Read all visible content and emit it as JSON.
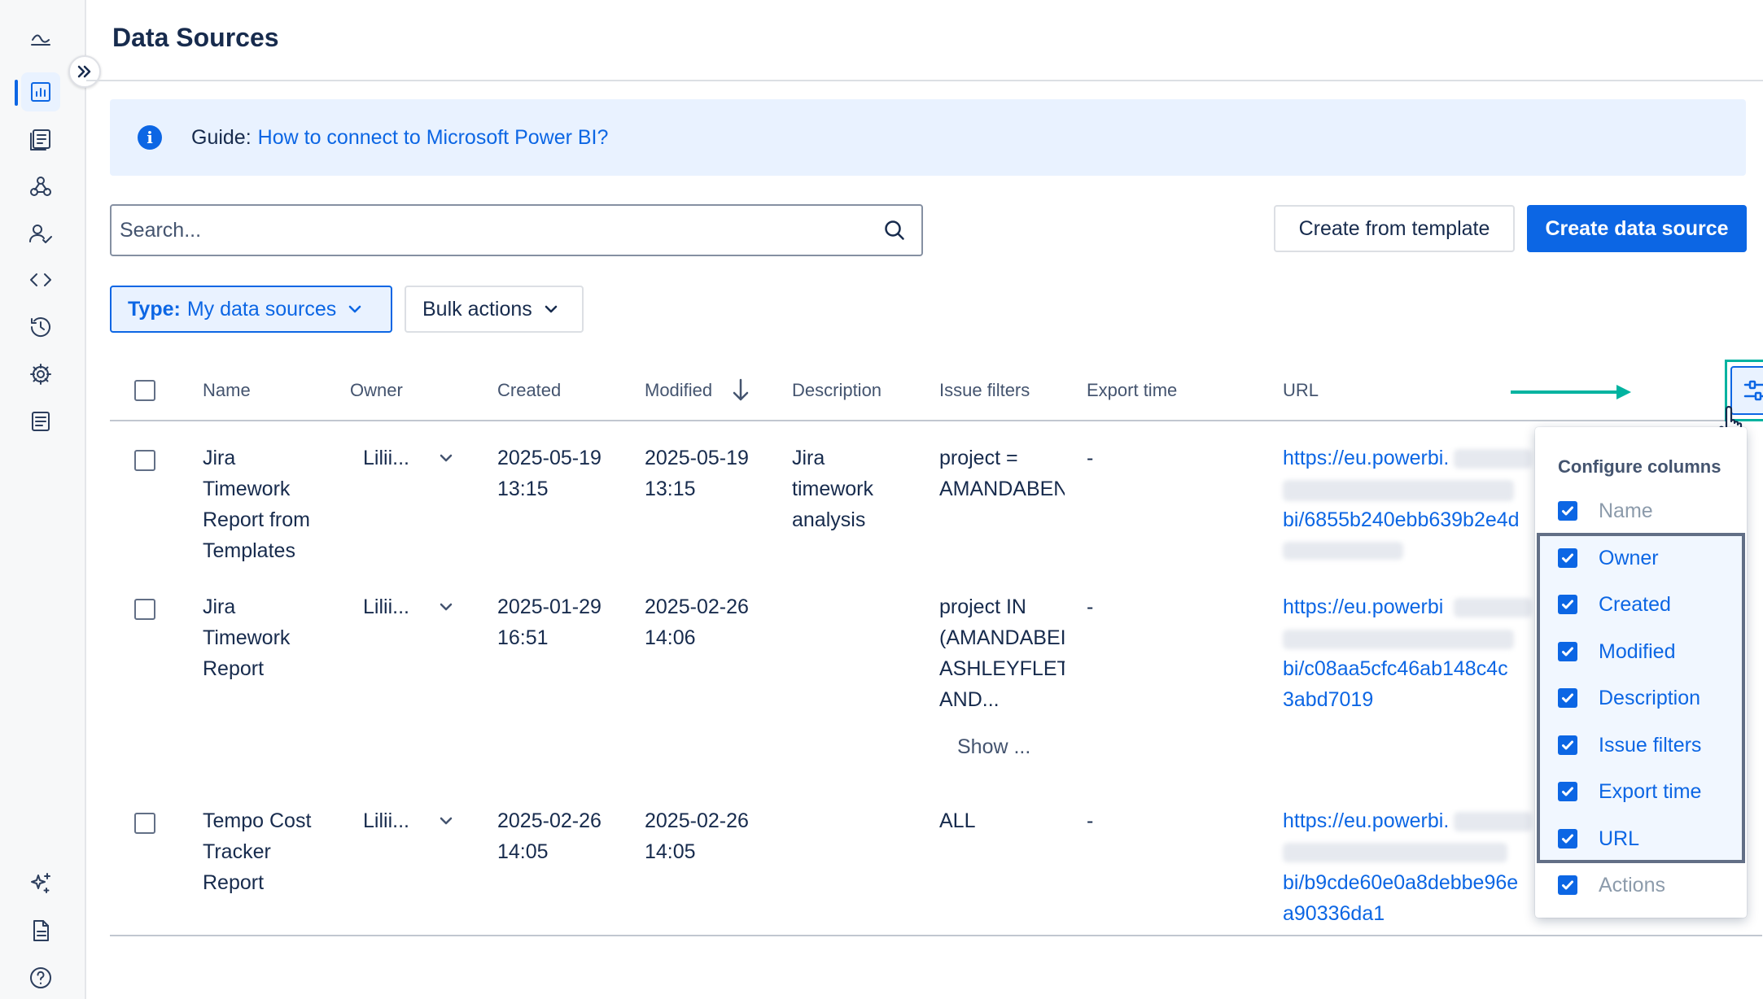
{
  "page": {
    "title": "Data Sources"
  },
  "sidebar": {
    "items": [
      {
        "name": "home",
        "icon": "home-icon"
      },
      {
        "name": "reports",
        "icon": "bar-chart-icon",
        "active": true
      },
      {
        "name": "documents",
        "icon": "document-list-icon"
      },
      {
        "name": "webhooks",
        "icon": "webhook-icon"
      },
      {
        "name": "users",
        "icon": "user-check-icon"
      },
      {
        "name": "api",
        "icon": "code-icon"
      },
      {
        "name": "history",
        "icon": "history-icon"
      },
      {
        "name": "settings",
        "icon": "gear-icon"
      },
      {
        "name": "logs",
        "icon": "file-text-icon"
      },
      {
        "name": "ai",
        "icon": "sparkle-icon"
      },
      {
        "name": "docs",
        "icon": "file-icon"
      },
      {
        "name": "help",
        "icon": "help-icon"
      }
    ]
  },
  "guide": {
    "label": "Guide:",
    "link_text": "How to connect to Microsoft Power BI?"
  },
  "search": {
    "placeholder": "Search..."
  },
  "actions": {
    "create_from_template": "Create from template",
    "create_data_source": "Create data source"
  },
  "filters": {
    "type_key": "Type:",
    "type_value": "My data sources",
    "bulk_actions": "Bulk actions"
  },
  "table": {
    "columns": [
      "Name",
      "Owner",
      "Created",
      "Modified",
      "Description",
      "Issue filters",
      "Export time",
      "URL"
    ],
    "sort_column": "Modified",
    "sort_direction": "descending",
    "rows": [
      {
        "name": [
          "Jira",
          "Timework",
          "Report from",
          "Templates"
        ],
        "owner": "Lilii...",
        "created": [
          "2025-05-19",
          "13:15"
        ],
        "modified": [
          "2025-05-19",
          "13:15"
        ],
        "description": [
          "Jira",
          "timework",
          "analysis"
        ],
        "issue_filters": [
          "project =",
          "AMANDABEN"
        ],
        "export_time": "-",
        "url": [
          "https://eu.powerbi.",
          "bi/6855b240ebb639b2e4d"
        ]
      },
      {
        "name": [
          "Jira",
          "Timework",
          "Report"
        ],
        "owner": "Lilii...",
        "created": [
          "2025-01-29",
          "16:51"
        ],
        "modified": [
          "2025-02-26",
          "14:06"
        ],
        "description": [],
        "issue_filters": [
          "project IN",
          "(AMANDABEI",
          "ASHLEYFLET",
          "AND..."
        ],
        "issue_filters_more": "Show ...",
        "export_time": "-",
        "url": [
          "https://eu.powerbi",
          "bi/c08aa5cfc46ab148c4c",
          "3abd7019"
        ]
      },
      {
        "name": [
          "Tempo Cost",
          "Tracker",
          "Report"
        ],
        "owner": "Lilii...",
        "created": [
          "2025-02-26",
          "14:05"
        ],
        "modified": [
          "2025-02-26",
          "14:05"
        ],
        "description": [],
        "issue_filters": [
          "ALL"
        ],
        "export_time": "-",
        "url": [
          "https://eu.powerbi.",
          "bi/b9cde60e0a8debbe96e",
          "a90336da1"
        ]
      }
    ]
  },
  "column_config": {
    "title": "Configure columns",
    "items": [
      {
        "label": "Name",
        "checked": true,
        "disabled": true
      },
      {
        "label": "Owner",
        "checked": true,
        "disabled": false
      },
      {
        "label": "Created",
        "checked": true,
        "disabled": false
      },
      {
        "label": "Modified",
        "checked": true,
        "disabled": false
      },
      {
        "label": "Description",
        "checked": true,
        "disabled": false
      },
      {
        "label": "Issue filters",
        "checked": true,
        "disabled": false
      },
      {
        "label": "Export time",
        "checked": true,
        "disabled": false
      },
      {
        "label": "URL",
        "checked": true,
        "disabled": false
      },
      {
        "label": "Actions",
        "checked": true,
        "disabled": true
      }
    ]
  },
  "colors": {
    "primary": "#0c66e4",
    "annotation": "#00b3a0",
    "text": "#172b4d",
    "subtle_text": "#44546f"
  }
}
